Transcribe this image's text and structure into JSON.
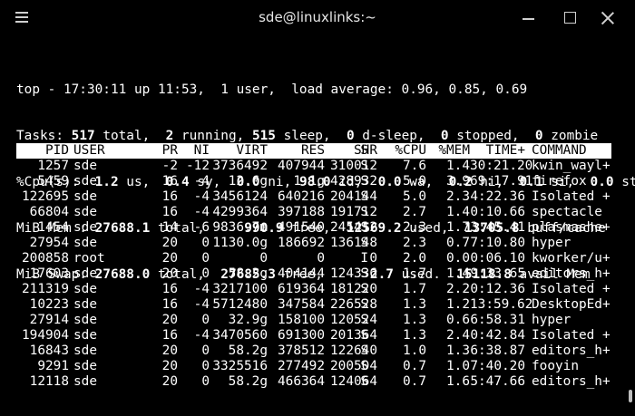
{
  "window": {
    "title": "sde@linuxlinks:~"
  },
  "summary": {
    "line1": "top - 17:30:11 up 11:53,  1 user,  load average: 0.96, 0.85, 0.69",
    "tasks": {
      "label": "Tasks: ",
      "total": "517",
      "total_label": " total,  ",
      "running": "2",
      "running_label": " running, ",
      "sleep": "515",
      "sleep_label": " sleep,  ",
      "dsleep": "0",
      "dsleep_label": " d-sleep,  ",
      "stopped": "0",
      "stopped_label": " stopped,  ",
      "zombie": "0",
      "zombie_label": " zombie"
    },
    "cpu": {
      "label": "%Cpu(s):  ",
      "us": "1.2",
      "us_label": " us,  ",
      "sy": "0.4",
      "sy_label": " sy,  ",
      "ni": "0.0",
      "ni_label": " ni, ",
      "id": "98.0",
      "id_label": " id,  ",
      "wa": "0.0",
      "wa_label": " wa,  ",
      "hi": "0.2",
      "hi_label": " hi,  ",
      "si": "0.1",
      "si_label": " si,  ",
      "st": "0.0",
      "st_label": " st"
    },
    "mem": {
      "label": "MiB Mem : ",
      "total": "27688.1",
      "total_label": " total,     ",
      "free": "990.9",
      "free_label": " free,  ",
      "used": "12569.2",
      "used_label": " used,  ",
      "buff": "13705.8",
      "buff_label": " buff/cache"
    },
    "swap": {
      "label": "MiB Swap: ",
      "total": "27688.0",
      "total_label": " total,  ",
      "free": "27685.3",
      "free_label": " free,      ",
      "used": "2.7",
      "used_label": " used.  ",
      "avail": "15118.8",
      "avail_label": " avail Mem"
    }
  },
  "columns": {
    "pid": "PID",
    "user": "USER",
    "pr": "PR",
    "ni": "NI",
    "virt": "VIRT",
    "res": "RES",
    "shr": "SHR",
    "s": "S",
    "cpu": "%CPU",
    "mem": "%MEM",
    "time": "TIME+",
    "command": "COMMAND"
  },
  "processes": [
    {
      "pid": "1257",
      "user": "sde",
      "pr": "-2",
      "ni": "-12",
      "virt": "3736492",
      "res": "407944",
      "shr": "310012",
      "s": "S",
      "cpu": "7.6",
      "mem": "1.4",
      "time": "30:21.20",
      "command": "kwin_wayl+"
    },
    {
      "pid": "5459",
      "user": "sde",
      "pr": "16",
      "ni": "-4",
      "virt": "12.6g",
      "res": "1.1g",
      "shr": "428932",
      "s": "S",
      "cpu": "5.0",
      "mem": "3.9",
      "time": "69:17.91",
      "command": "firefox"
    },
    {
      "pid": "122695",
      "user": "sde",
      "pr": "16",
      "ni": "-4",
      "virt": "3456124",
      "res": "640216",
      "shr": "204144",
      "s": "S",
      "cpu": "5.0",
      "mem": "2.3",
      "time": "4:22.36",
      "command": "Isolated +"
    },
    {
      "pid": "66804",
      "user": "sde",
      "pr": "16",
      "ni": "-4",
      "virt": "4299364",
      "res": "397188",
      "shr": "191712",
      "s": "S",
      "cpu": "2.7",
      "mem": "1.4",
      "time": "0:10.66",
      "command": "spectacle"
    },
    {
      "pid": "1454",
      "user": "sde",
      "pr": "14",
      "ni": "-6",
      "virt": "9836.7m",
      "res": "491540",
      "shr": "245412",
      "s": "S",
      "cpu": "2.3",
      "mem": "1.7",
      "time": "3:45.41",
      "command": "plasmashe+"
    },
    {
      "pid": "27954",
      "user": "sde",
      "pr": "20",
      "ni": "0",
      "virt": "1130.0g",
      "res": "186692",
      "shr": "136148",
      "s": "S",
      "cpu": "2.3",
      "mem": "0.7",
      "time": "7:10.80",
      "command": "hyper"
    },
    {
      "pid": "200858",
      "user": "root",
      "pr": "20",
      "ni": "0",
      "virt": "0",
      "res": "0",
      "shr": "0",
      "s": "I",
      "cpu": "2.0",
      "mem": "0.0",
      "time": "0:06.10",
      "command": "kworker/u+"
    },
    {
      "pid": "17603",
      "user": "sde",
      "pr": "20",
      "ni": "0",
      "virt": "58.2g",
      "res": "404144",
      "shr": "124336",
      "s": "S",
      "cpu": "1.7",
      "mem": "1.4",
      "time": "9:33.65",
      "command": "editors_h+"
    },
    {
      "pid": "211319",
      "user": "sde",
      "pr": "16",
      "ni": "-4",
      "virt": "3217100",
      "res": "619364",
      "shr": "181220",
      "s": "S",
      "cpu": "1.7",
      "mem": "2.2",
      "time": "0:12.36",
      "command": "Isolated +"
    },
    {
      "pid": "10223",
      "user": "sde",
      "pr": "16",
      "ni": "-4",
      "virt": "5712480",
      "res": "347584",
      "shr": "226528",
      "s": "S",
      "cpu": "1.3",
      "mem": "1.2",
      "time": "13:59.62",
      "command": "DesktopEd+"
    },
    {
      "pid": "27914",
      "user": "sde",
      "pr": "20",
      "ni": "0",
      "virt": "32.9g",
      "res": "158100",
      "shr": "120524",
      "s": "S",
      "cpu": "1.3",
      "mem": "0.6",
      "time": "6:58.31",
      "command": "hyper"
    },
    {
      "pid": "194904",
      "user": "sde",
      "pr": "16",
      "ni": "-4",
      "virt": "3470560",
      "res": "691300",
      "shr": "201364",
      "s": "S",
      "cpu": "1.3",
      "mem": "2.4",
      "time": "0:42.84",
      "command": "Isolated +"
    },
    {
      "pid": "16843",
      "user": "sde",
      "pr": "20",
      "ni": "0",
      "virt": "58.2g",
      "res": "378512",
      "shr": "122640",
      "s": "S",
      "cpu": "1.0",
      "mem": "1.3",
      "time": "6:38.87",
      "command": "editors_h+"
    },
    {
      "pid": "9291",
      "user": "sde",
      "pr": "20",
      "ni": "0",
      "virt": "3325516",
      "res": "277492",
      "shr": "200504",
      "s": "S",
      "cpu": "0.7",
      "mem": "1.0",
      "time": "7:40.20",
      "command": "fooyin"
    },
    {
      "pid": "12118",
      "user": "sde",
      "pr": "20",
      "ni": "0",
      "virt": "58.2g",
      "res": "466364",
      "shr": "124064",
      "s": "S",
      "cpu": "0.7",
      "mem": "1.6",
      "time": "5:47.66",
      "command": "editors_h+"
    }
  ],
  "colors": {
    "background": "#000000",
    "foreground": "#ffffff",
    "header_bg": "#ffffff",
    "header_fg": "#000000"
  }
}
